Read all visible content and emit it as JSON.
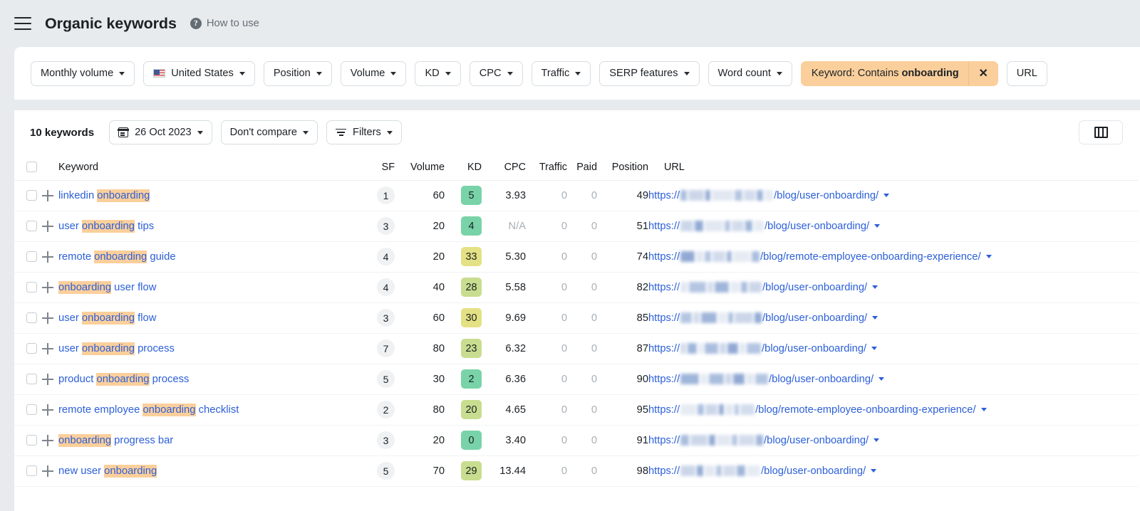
{
  "header": {
    "menu_icon": "hamburger-icon",
    "title": "Organic keywords",
    "help_icon": "question-mark-icon",
    "howto_label": "How to use"
  },
  "filters": {
    "buttons": [
      {
        "label": "Monthly volume",
        "icon": null
      },
      {
        "label": "United States",
        "icon": "us-flag-icon"
      },
      {
        "label": "Position",
        "icon": null
      },
      {
        "label": "Volume",
        "icon": null
      },
      {
        "label": "KD",
        "icon": null
      },
      {
        "label": "CPC",
        "icon": null
      },
      {
        "label": "Traffic",
        "icon": null
      },
      {
        "label": "SERP features",
        "icon": null
      },
      {
        "label": "Word count",
        "icon": null
      }
    ],
    "active_chip": {
      "prefix": "Keyword: Contains",
      "value": "onboarding",
      "remove_icon": "close-icon",
      "bg_color": "#fbcf9b"
    },
    "overflow_button": "URL"
  },
  "toolbar": {
    "keyword_count": "10 keywords",
    "date_button": "26 Oct 2023",
    "date_icon": "calendar-icon",
    "compare_button": "Don't compare",
    "filters_button": "Filters",
    "filters_icon": "filter-icon",
    "columns_icon": "columns-icon"
  },
  "table": {
    "columns": [
      "Keyword",
      "SF",
      "Volume",
      "KD",
      "CPC",
      "Traffic",
      "Paid",
      "Position",
      "URL"
    ],
    "rows": [
      {
        "keyword_parts": [
          {
            "t": "linkedin ",
            "h": false
          },
          {
            "t": "onboarding",
            "h": true
          }
        ],
        "sf": "1",
        "volume": "60",
        "kd": "5",
        "kd_color": "#79d3a8",
        "cpc": "3.93",
        "cpc_na": false,
        "traffic": "0",
        "paid": "0",
        "position": "49",
        "url_prefix": "https://",
        "url_path": "/blog/user-onboarding/",
        "blur_widths": [
          9,
          22,
          7,
          30,
          11,
          16,
          9,
          12
        ]
      },
      {
        "keyword_parts": [
          {
            "t": "user ",
            "h": false
          },
          {
            "t": "onboarding",
            "h": true
          },
          {
            "t": " tips",
            "h": false
          }
        ],
        "sf": "3",
        "volume": "20",
        "kd": "4",
        "kd_color": "#79d3a8",
        "cpc": "N/A",
        "cpc_na": true,
        "traffic": "0",
        "paid": "0",
        "position": "51",
        "url_prefix": "https://",
        "url_path": "/blog/user-onboarding/",
        "blur_widths": [
          18,
          12,
          26,
          8,
          17,
          10,
          14
        ]
      },
      {
        "keyword_parts": [
          {
            "t": "remote ",
            "h": false
          },
          {
            "t": "onboarding",
            "h": true
          },
          {
            "t": " guide",
            "h": false
          }
        ],
        "sf": "4",
        "volume": "20",
        "kd": "33",
        "kd_color": "#e4e184",
        "cpc": "5.30",
        "cpc_na": false,
        "traffic": "0",
        "paid": "0",
        "position": "74",
        "url_prefix": "https://",
        "url_path": "/blog/remote-employee-onboarding-experience/",
        "blur_widths": [
          20,
          10,
          9,
          18,
          7,
          24,
          11
        ]
      },
      {
        "keyword_parts": [
          {
            "t": "onboarding",
            "h": true
          },
          {
            "t": " user flow",
            "h": false
          }
        ],
        "sf": "4",
        "volume": "40",
        "kd": "28",
        "kd_color": "#c8dd8f",
        "cpc": "5.58",
        "cpc_na": false,
        "traffic": "0",
        "paid": "0",
        "position": "82",
        "url_prefix": "https://",
        "url_path": "/blog/user-onboarding/",
        "blur_widths": [
          10,
          24,
          8,
          20,
          13,
          9,
          18
        ]
      },
      {
        "keyword_parts": [
          {
            "t": "user ",
            "h": false
          },
          {
            "t": "onboarding",
            "h": true
          },
          {
            "t": " flow",
            "h": false
          }
        ],
        "sf": "3",
        "volume": "60",
        "kd": "30",
        "kd_color": "#e4e184",
        "cpc": "9.69",
        "cpc_na": false,
        "traffic": "0",
        "paid": "0",
        "position": "85",
        "url_prefix": "https://",
        "url_path": "/blog/user-onboarding/",
        "blur_widths": [
          16,
          9,
          22,
          12,
          7,
          26,
          10
        ]
      },
      {
        "keyword_parts": [
          {
            "t": "user ",
            "h": false
          },
          {
            "t": "onboarding",
            "h": true
          },
          {
            "t": " process",
            "h": false
          }
        ],
        "sf": "7",
        "volume": "80",
        "kd": "23",
        "kd_color": "#c8dd8f",
        "cpc": "6.32",
        "cpc_na": false,
        "traffic": "0",
        "paid": "0",
        "position": "87",
        "url_prefix": "https://",
        "url_path": "/blog/user-onboarding/",
        "blur_widths": [
          8,
          13,
          7,
          19,
          9,
          15,
          8,
          20
        ]
      },
      {
        "keyword_parts": [
          {
            "t": "product ",
            "h": false
          },
          {
            "t": "onboarding",
            "h": true
          },
          {
            "t": " process",
            "h": false
          }
        ],
        "sf": "5",
        "volume": "30",
        "kd": "2",
        "kd_color": "#79d3a8",
        "cpc": "6.36",
        "cpc_na": false,
        "traffic": "0",
        "paid": "0",
        "position": "90",
        "url_prefix": "https://",
        "url_path": "/blog/user-onboarding/",
        "blur_widths": [
          26,
          10,
          21,
          9,
          16,
          11,
          18
        ]
      },
      {
        "keyword_parts": [
          {
            "t": "remote employee ",
            "h": false
          },
          {
            "t": "onboarding",
            "h": true
          },
          {
            "t": " checklist",
            "h": false
          }
        ],
        "sf": "2",
        "volume": "80",
        "kd": "20",
        "kd_color": "#c8dd8f",
        "cpc": "4.65",
        "cpc_na": false,
        "traffic": "0",
        "paid": "0",
        "position": "95",
        "url_prefix": "https://",
        "url_path": "/blog/remote-employee-onboarding-experience/",
        "blur_widths": [
          22,
          9,
          17,
          7,
          11,
          6,
          20
        ]
      },
      {
        "keyword_parts": [
          {
            "t": "onboarding",
            "h": true
          },
          {
            "t": " progress bar",
            "h": false
          }
        ],
        "sf": "3",
        "volume": "20",
        "kd": "0",
        "kd_color": "#79d3a8",
        "cpc": "3.40",
        "cpc_na": false,
        "traffic": "0",
        "paid": "0",
        "position": "91",
        "url_prefix": "https://",
        "url_path": "/blog/user-onboarding/",
        "blur_widths": [
          12,
          24,
          9,
          19,
          8,
          22,
          10
        ]
      },
      {
        "keyword_parts": [
          {
            "t": "new user ",
            "h": false
          },
          {
            "t": "onboarding",
            "h": true
          }
        ],
        "sf": "5",
        "volume": "70",
        "kd": "29",
        "kd_color": "#c8dd8f",
        "cpc": "13.44",
        "cpc_na": false,
        "traffic": "0",
        "paid": "0",
        "position": "98",
        "url_prefix": "https://",
        "url_path": "/blog/user-onboarding/",
        "blur_widths": [
          21,
          9,
          14,
          8,
          17,
          12,
          19
        ]
      }
    ]
  },
  "colors": {
    "link": "#2b5fd9",
    "highlight": "#fbcf9b",
    "page_bg": "#e7ebee",
    "card_bg": "#ffffff"
  }
}
